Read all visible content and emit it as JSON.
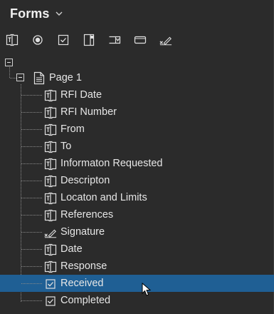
{
  "panel": {
    "title": "Forms",
    "title_chevron_icon": "chevron-down-icon"
  },
  "toolbar": {
    "tools": [
      {
        "name": "text-field-tool",
        "icon": "text-field-icon"
      },
      {
        "name": "radio-button-tool",
        "icon": "radio-button-icon"
      },
      {
        "name": "checkbox-tool",
        "icon": "checkbox-icon"
      },
      {
        "name": "list-box-tool",
        "icon": "list-box-icon"
      },
      {
        "name": "dropdown-tool",
        "icon": "dropdown-icon"
      },
      {
        "name": "button-tool",
        "icon": "button-icon"
      },
      {
        "name": "signature-tool",
        "icon": "signature-icon"
      }
    ]
  },
  "tree": {
    "root_label": "",
    "page": {
      "label": "Page 1",
      "icon": "page-icon"
    },
    "fields": [
      {
        "label": "RFI Date",
        "icon": "text-field-icon",
        "selected": false
      },
      {
        "label": "RFI Number",
        "icon": "text-field-icon",
        "selected": false
      },
      {
        "label": "From",
        "icon": "text-field-icon",
        "selected": false
      },
      {
        "label": "To",
        "icon": "text-field-icon",
        "selected": false
      },
      {
        "label": "Informaton Requested",
        "icon": "text-field-icon",
        "selected": false
      },
      {
        "label": "Descripton",
        "icon": "text-field-icon",
        "selected": false
      },
      {
        "label": "Locaton and Limits",
        "icon": "text-field-icon",
        "selected": false
      },
      {
        "label": "References",
        "icon": "text-field-icon",
        "selected": false
      },
      {
        "label": "Signature",
        "icon": "signature-icon",
        "selected": false
      },
      {
        "label": "Date",
        "icon": "text-field-icon",
        "selected": false
      },
      {
        "label": "Response",
        "icon": "text-field-icon",
        "selected": false
      },
      {
        "label": "Received",
        "icon": "checkbox-icon",
        "selected": true
      },
      {
        "label": "Completed",
        "icon": "checkbox-icon",
        "selected": false
      }
    ]
  },
  "colors": {
    "background": "#2b2b2b",
    "selection": "#1f5f94",
    "text": "#e6e6e6"
  }
}
